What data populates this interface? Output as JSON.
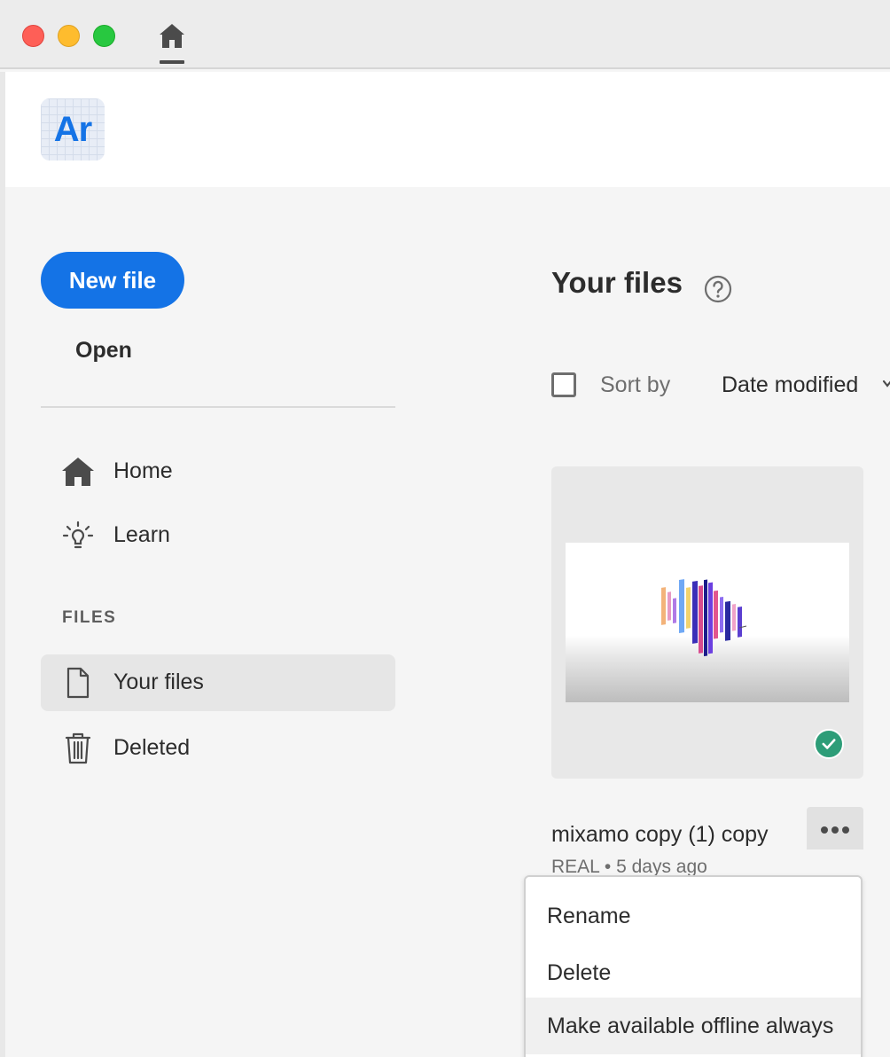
{
  "window": {
    "controls": [
      "close",
      "minimize",
      "zoom"
    ],
    "tabs": [
      {
        "icon": "home-icon"
      }
    ]
  },
  "app": {
    "logo_text": "Ar"
  },
  "sidebar": {
    "new_file_label": "New file",
    "open_label": "Open",
    "nav": [
      {
        "label": "Home",
        "icon": "home-icon"
      },
      {
        "label": "Learn",
        "icon": "lightbulb-icon"
      }
    ],
    "section_label": "FILES",
    "files_nav": [
      {
        "label": "Your files",
        "icon": "document-icon",
        "selected": true
      },
      {
        "label": "Deleted",
        "icon": "trash-icon",
        "selected": false
      }
    ]
  },
  "main": {
    "title": "Your files",
    "sort_label": "Sort by",
    "sort_value": "Date modified",
    "files": [
      {
        "name": "mixamo copy (1) copy",
        "meta": "REAL • 5 days ago",
        "synced": true
      }
    ]
  },
  "context_menu": {
    "items": [
      "Rename",
      "Delete",
      "Make available offline always"
    ]
  },
  "colors": {
    "accent": "#1473e6",
    "sync_ok": "#2d9d78"
  }
}
